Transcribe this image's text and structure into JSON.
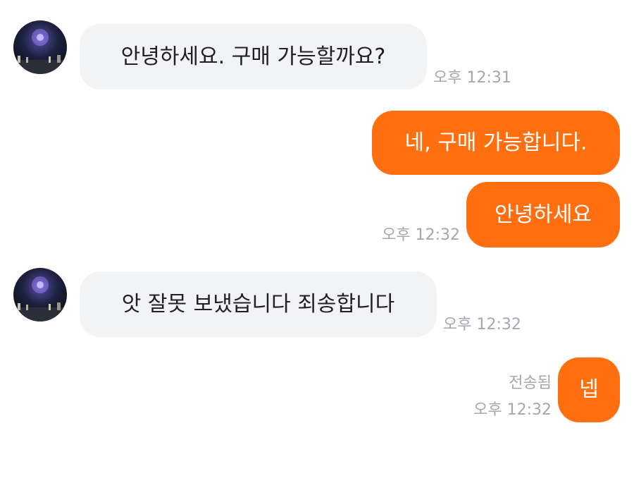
{
  "messages": [
    {
      "id": "m1",
      "direction": "incoming",
      "text": "안녕하세요. 구매 가능할까요?",
      "time": "오후 12:31"
    },
    {
      "id": "m2",
      "direction": "outgoing",
      "text": "네, 구매 가능합니다."
    },
    {
      "id": "m3",
      "direction": "outgoing",
      "text": "안녕하세요",
      "time": "오후 12:32"
    },
    {
      "id": "m4",
      "direction": "incoming",
      "text": "앗 잘못 보냈습니다 죄송합니다",
      "time": "오후 12:32"
    },
    {
      "id": "m5",
      "direction": "outgoing",
      "text": "넵",
      "status": "전송됨",
      "time": "오후 12:32"
    }
  ],
  "colors": {
    "outgoing_bubble": "#ff6f0f",
    "incoming_bubble": "#f2f3f5",
    "meta_text": "#a4a7ad"
  },
  "icons": {
    "avatar": "avatar-night-drone-show"
  }
}
